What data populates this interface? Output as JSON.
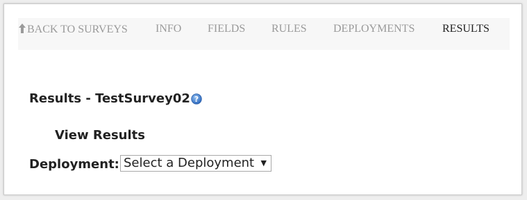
{
  "nav": {
    "back_label": "BACK TO SURVEYS",
    "tabs": [
      {
        "label": "INFO"
      },
      {
        "label": "FIELDS"
      },
      {
        "label": "RULES"
      },
      {
        "label": "DEPLOYMENTS"
      },
      {
        "label": "RESULTS",
        "active": true
      }
    ]
  },
  "page": {
    "title": "Results - TestSurvey02",
    "subtitle": "View Results"
  },
  "deployment": {
    "label": "Deployment:",
    "selected": "Select a Deployment"
  },
  "icons": {
    "back": "up-arrow-icon",
    "help": "help-question-icon",
    "dropdown": "caret-down-icon"
  },
  "colors": {
    "nav_inactive": "#9a9a9a",
    "nav_active": "#222222",
    "help_icon": "#3a78c9"
  }
}
